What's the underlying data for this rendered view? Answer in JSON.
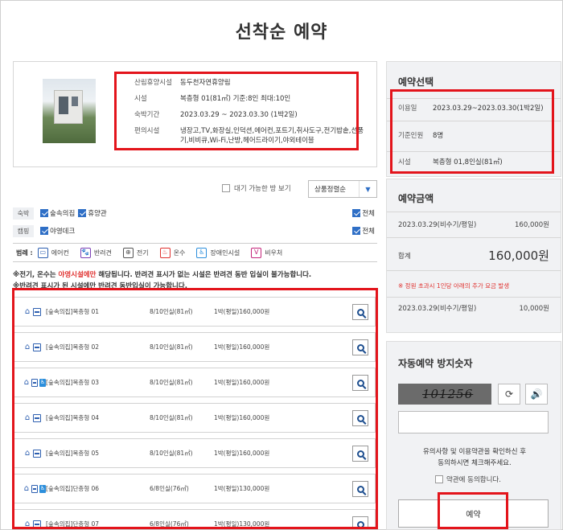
{
  "page": {
    "title": "선착순 예약"
  },
  "facility": {
    "rows": [
      {
        "label": "산림휴양시설",
        "value": "동두천자연휴양림"
      },
      {
        "label": "시설",
        "value": "복층형 01(81㎡) 기준:8인 최대:10인"
      },
      {
        "label": "숙박기간",
        "value": "2023.03.29 ~ 2023.03.30 (1박2일)"
      },
      {
        "label": "편의시설",
        "value": "냉장고,TV,화장실,인덕션,에어컨,포트기,취사도구,전기밥솥,선풍기,비비큐,Wi-Fi,난방,헤어드라이기,야외테이블"
      }
    ]
  },
  "filter": {
    "wait_label": "대기 가능한 방 보기",
    "sort_label": "상품정렬순",
    "stay": {
      "tag": "숙박",
      "options": [
        "숲속의집",
        "휴양관"
      ],
      "all": "전체"
    },
    "camp": {
      "tag": "캠핑",
      "options": [
        "야영데크"
      ],
      "all": "전체"
    }
  },
  "legend": {
    "title": "범례 :",
    "items": [
      {
        "label": "에어컨",
        "icon": "aircon-icon",
        "glyph": "▭",
        "color": "#2d5fb0"
      },
      {
        "label": "반려견",
        "icon": "pet-icon",
        "glyph": "🐾",
        "color": "#7b3fb5"
      },
      {
        "label": "전기",
        "icon": "electric-icon",
        "glyph": "⊕",
        "color": "#555555"
      },
      {
        "label": "온수",
        "icon": "hotwater-icon",
        "glyph": "♨",
        "color": "#e0312f"
      },
      {
        "label": "장애인시설",
        "icon": "accessible-icon",
        "glyph": "♿",
        "color": "#2d8fdc"
      },
      {
        "label": "비우처",
        "icon": "voucher-icon",
        "glyph": "V",
        "color": "#c4247a"
      }
    ]
  },
  "notices": {
    "n1_a": "※전기, 온수는 ",
    "n1_red": "야영시설에만",
    "n1_b": " 해당됩니다. 반려견 표시가 없는 시설은 반려견 동반 입실이 불가능합니다.",
    "n2": "※반려견 표시가 된 시설에만 반려견 동반입실이 가능합니다."
  },
  "rooms": [
    {
      "name": "[숲속의집]복층형 01",
      "capacity": "8/10인실(81㎡)",
      "price": "1박(평일)160,000원",
      "accessible": false
    },
    {
      "name": "[숲속의집]복층형 02",
      "capacity": "8/10인실(81㎡)",
      "price": "1박(평일)160,000원",
      "accessible": false
    },
    {
      "name": "[숲속의집]복층형 03",
      "capacity": "8/10인실(81㎡)",
      "price": "1박(평일)160,000원",
      "accessible": true
    },
    {
      "name": "[숲속의집]복층형 04",
      "capacity": "8/10인실(81㎡)",
      "price": "1박(평일)160,000원",
      "accessible": false
    },
    {
      "name": "[숲속의집]복층형 05",
      "capacity": "8/10인실(81㎡)",
      "price": "1박(평일)160,000원",
      "accessible": false
    },
    {
      "name": "[숲속의집]단층형 06",
      "capacity": "6/8인실(76㎡)",
      "price": "1박(평일)130,000원",
      "accessible": true
    },
    {
      "name": "[숲속의집]단층형 07",
      "capacity": "6/8인실(76㎡)",
      "price": "1박(평일)130,000원",
      "accessible": false
    }
  ],
  "selection": {
    "title": "예약선택",
    "use_date_label": "이용일",
    "use_date": "2023.03.29~2023.03.30(1박2일)",
    "people_label": "기준인원",
    "people": "8명",
    "facility_label": "시설",
    "facility": "복층형 01,8인실(81㎡)"
  },
  "amount": {
    "title": "예약금액",
    "line_label": "2023.03.29(비수기/평일)",
    "line_value": "160,000원",
    "total_label": "합계",
    "total_value": "160,000원",
    "warn": "※ 정원 초과시 1인당 아래의 추가 요금 발생",
    "extra_label": "2023.03.29(비수기/평일)",
    "extra_value": "10,000원"
  },
  "captcha": {
    "title": "자동예약 방지숫자",
    "code": "101256",
    "input_value": "",
    "agree_line1": "유의사항 및 이용약관을 확인하신 후",
    "agree_line2": "동의하시면 체크해주세요.",
    "agree_check": "약관에 동의합니다.",
    "reserve_label": "예약"
  },
  "colors": {
    "highlight": "#e3141b",
    "accent": "#2f6fc6",
    "warn": "#e0312f"
  }
}
